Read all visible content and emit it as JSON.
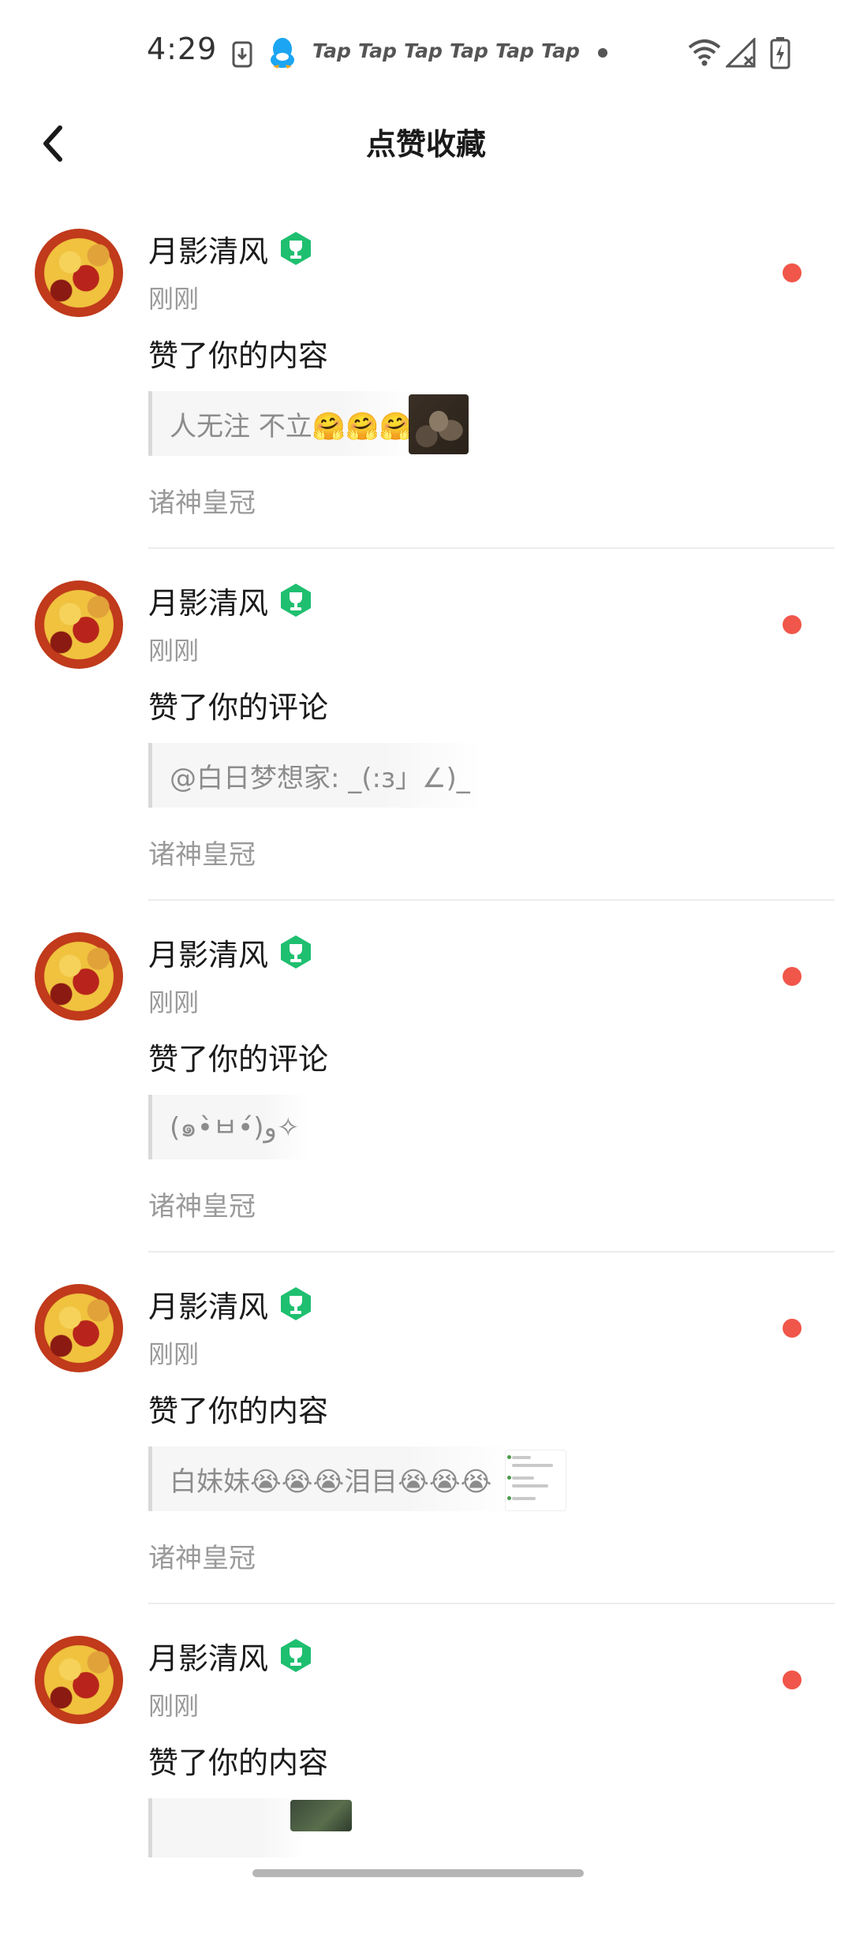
{
  "status_bar": {
    "time": "4:29",
    "notification_icons": [
      "download-icon",
      "qq-penguin-icon"
    ],
    "tap_labels": [
      "Tap",
      "Tap",
      "Tap",
      "Tap",
      "Tap",
      "Tap"
    ],
    "system_icons": [
      "wifi-icon",
      "signal-off-icon",
      "battery-charging-icon"
    ]
  },
  "header": {
    "back_icon": "chevron-left-icon",
    "title": "点赞收藏"
  },
  "colors": {
    "unread_dot": "#f0564a",
    "badge_green": "#1fbf70",
    "secondary_text": "#9a9a9a",
    "quote_bar": "#d9d9d9"
  },
  "notifications": [
    {
      "user_name": "月影清风",
      "badge_icon": "trophy-badge-icon",
      "time": "刚刚",
      "action": "赞了你的内容",
      "quote": "人无注 不立🤗🤗🤗",
      "thumbnail_icon": "dark-artwork-thumbnail",
      "source": "诸神皇冠",
      "unread": true
    },
    {
      "user_name": "月影清风",
      "badge_icon": "trophy-badge-icon",
      "time": "刚刚",
      "action": "赞了你的评论",
      "quote": "@白日梦想家: _(:з」∠)_",
      "source": "诸神皇冠",
      "unread": true
    },
    {
      "user_name": "月影清风",
      "badge_icon": "trophy-badge-icon",
      "time": "刚刚",
      "action": "赞了你的评论",
      "quote": "(๑•̀ㅂ•́)و✧",
      "source": "诸神皇冠",
      "unread": true
    },
    {
      "user_name": "月影清风",
      "badge_icon": "trophy-badge-icon",
      "time": "刚刚",
      "action": "赞了你的内容",
      "quote": "白妹妹😭😭😭泪目😭😭😭",
      "thumbnail_icon": "chat-screenshot-thumbnail",
      "source": "诸神皇冠",
      "unread": true
    },
    {
      "user_name": "月影清风",
      "badge_icon": "trophy-badge-icon",
      "time": "刚刚",
      "action": "赞了你的内容",
      "quote": "",
      "thumbnail_icon": "game-scene-thumbnail",
      "unread": true
    }
  ]
}
